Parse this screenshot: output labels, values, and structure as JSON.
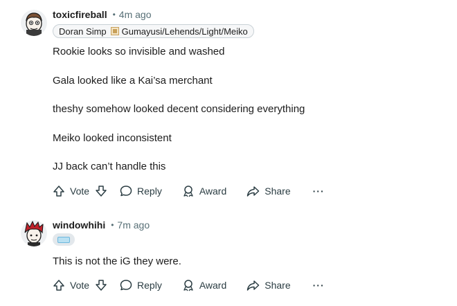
{
  "comments": [
    {
      "username": "toxicfireball",
      "time": "4m ago",
      "flair": {
        "text_before": "Doran Simp",
        "text_after": "Gumayusi/Lehends/Light/Meiko"
      },
      "lines": [
        "Rookie looks so invisible and washed",
        "Gala looked like a Kai’sa merchant",
        "theshy somehow looked decent considering everything",
        "Meiko looked inconsistent",
        "JJ back can’t handle this"
      ]
    },
    {
      "username": "windowhihi",
      "time": "7m ago",
      "lines": [
        "This is not the iG they were."
      ]
    }
  ],
  "actions": {
    "vote_label": "Vote",
    "reply_label": "Reply",
    "award_label": "Award",
    "share_label": "Share",
    "more_label": "···"
  },
  "icons": {
    "upvote": "arrow-up-icon",
    "downvote": "arrow-down-icon",
    "reply": "speech-bubble-icon",
    "award": "award-icon",
    "share": "share-arrow-icon",
    "more": "ellipsis-icon"
  },
  "colors": {
    "text": "#1c1c1c",
    "meta": "#576f76",
    "action": "#2a3c42",
    "flair_bg": "#f6f7f8"
  }
}
